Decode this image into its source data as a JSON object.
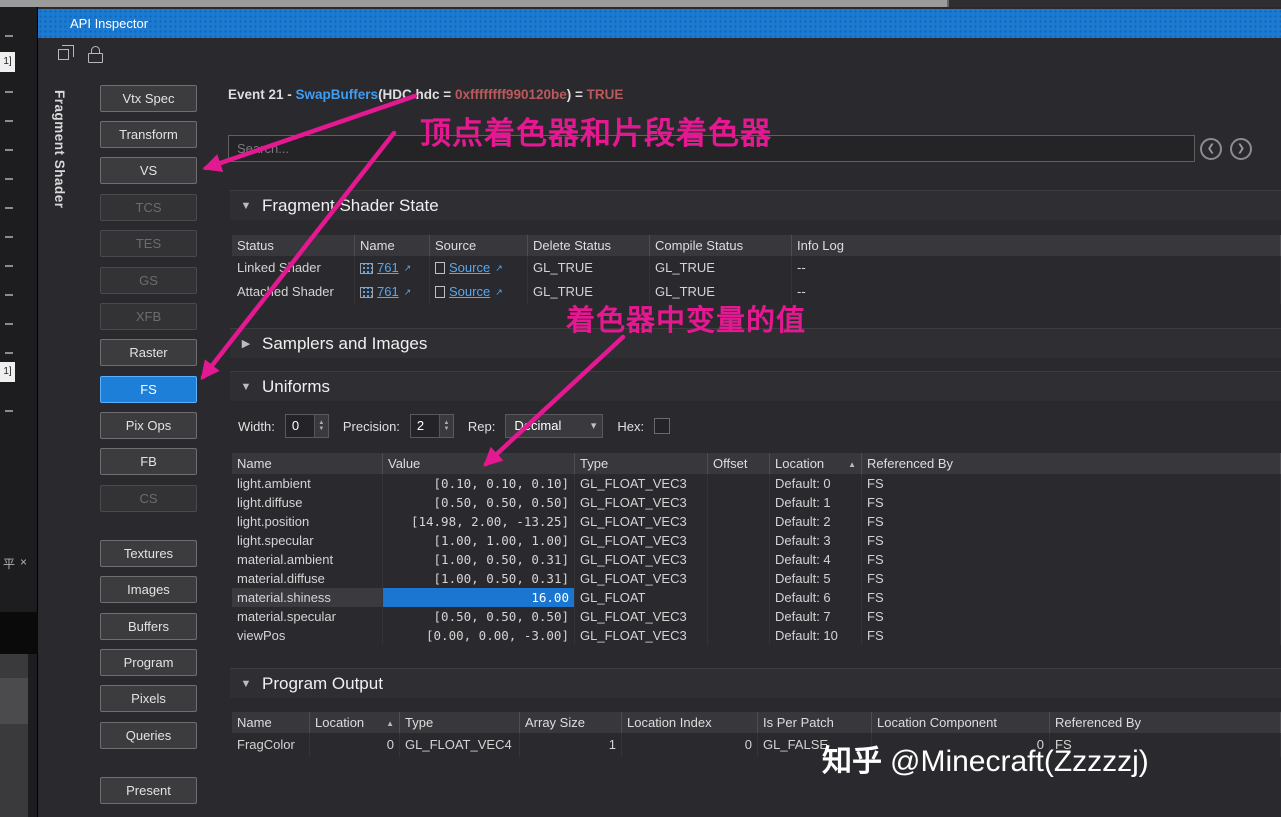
{
  "window": {
    "title": "API Inspector"
  },
  "toolbar": {
    "icons": [
      "clone-icon",
      "lock-icon"
    ]
  },
  "left_rail": {
    "tag1": "1]",
    "tag2": "1]",
    "pin": "平",
    "close": "×"
  },
  "sidebar": {
    "group_label": "Fragment Shader",
    "buttons": [
      {
        "label": "Vtx Spec"
      },
      {
        "label": "Transform"
      },
      {
        "label": "VS"
      },
      {
        "label": "TCS"
      },
      {
        "label": "TES"
      },
      {
        "label": "GS"
      },
      {
        "label": "XFB"
      },
      {
        "label": "Raster"
      },
      {
        "label": "FS"
      },
      {
        "label": "Pix Ops"
      },
      {
        "label": "FB"
      },
      {
        "label": "CS"
      },
      {
        "label": "Textures"
      },
      {
        "label": "Images"
      },
      {
        "label": "Buffers"
      },
      {
        "label": "Program"
      },
      {
        "label": "Pixels"
      },
      {
        "label": "Queries"
      },
      {
        "label": "Present"
      }
    ]
  },
  "event_line": {
    "prefix": "Event 21 - ",
    "func": "SwapBuffers",
    "args_open": "(HDC hdc = ",
    "pointer": "0xffffffff990120be",
    "args_close": ") = ",
    "result": "TRUE"
  },
  "search": {
    "placeholder": "Search..."
  },
  "fragment_shader_state": {
    "title": "Fragment Shader State",
    "columns": [
      "Status",
      "Name",
      "Source",
      "Delete Status",
      "Compile Status",
      "Info Log"
    ],
    "rows": [
      {
        "status": "Linked Shader",
        "name_link": "761",
        "source_link": "Source",
        "delete_status": "GL_TRUE",
        "compile_status": "GL_TRUE",
        "info_log": "--"
      },
      {
        "status": "Attached Shader",
        "name_link": "761",
        "source_link": "Source",
        "delete_status": "GL_TRUE",
        "compile_status": "GL_TRUE",
        "info_log": "--"
      }
    ]
  },
  "samplers_section": {
    "title": "Samplers and Images"
  },
  "uniforms": {
    "title": "Uniforms",
    "controls": {
      "width_label": "Width:",
      "width_value": "0",
      "precision_label": "Precision:",
      "precision_value": "2",
      "rep_label": "Rep:",
      "rep_value": "Decimal",
      "hex_label": "Hex:"
    },
    "columns": [
      "Name",
      "Value",
      "Type",
      "Offset",
      "Location",
      "Referenced By"
    ],
    "sort_column": "Location",
    "rows": [
      {
        "name": "light.ambient",
        "value": "[0.10, 0.10, 0.10]",
        "type": "GL_FLOAT_VEC3",
        "offset": "",
        "location": "Default: 0",
        "referenced_by": "FS"
      },
      {
        "name": "light.diffuse",
        "value": "[0.50, 0.50, 0.50]",
        "type": "GL_FLOAT_VEC3",
        "offset": "",
        "location": "Default: 1",
        "referenced_by": "FS"
      },
      {
        "name": "light.position",
        "value": "[14.98, 2.00, -13.25]",
        "type": "GL_FLOAT_VEC3",
        "offset": "",
        "location": "Default: 2",
        "referenced_by": "FS"
      },
      {
        "name": "light.specular",
        "value": "[1.00, 1.00, 1.00]",
        "type": "GL_FLOAT_VEC3",
        "offset": "",
        "location": "Default: 3",
        "referenced_by": "FS"
      },
      {
        "name": "material.ambient",
        "value": "[1.00, 0.50, 0.31]",
        "type": "GL_FLOAT_VEC3",
        "offset": "",
        "location": "Default: 4",
        "referenced_by": "FS"
      },
      {
        "name": "material.diffuse",
        "value": "[1.00, 0.50, 0.31]",
        "type": "GL_FLOAT_VEC3",
        "offset": "",
        "location": "Default: 5",
        "referenced_by": "FS"
      },
      {
        "name": "material.shiness",
        "value": "16.00",
        "type": "GL_FLOAT",
        "offset": "",
        "location": "Default: 6",
        "referenced_by": "FS"
      },
      {
        "name": "material.specular",
        "value": "[0.50, 0.50, 0.50]",
        "type": "GL_FLOAT_VEC3",
        "offset": "",
        "location": "Default: 7",
        "referenced_by": "FS"
      },
      {
        "name": "viewPos",
        "value": "[0.00, 0.00, -3.00]",
        "type": "GL_FLOAT_VEC3",
        "offset": "",
        "location": "Default: 10",
        "referenced_by": "FS"
      }
    ]
  },
  "program_output": {
    "title": "Program Output",
    "columns": [
      "Name",
      "Location",
      "Type",
      "Array Size",
      "Location Index",
      "Is Per Patch",
      "Location Component",
      "Referenced By"
    ],
    "sort_column": "Location",
    "rows": [
      {
        "name": "FragColor",
        "location": "0",
        "type": "GL_FLOAT_VEC4",
        "array_size": "1",
        "location_index": "0",
        "is_per_patch": "GL_FALSE",
        "location_component": "0",
        "referenced_by": "FS"
      }
    ]
  },
  "annotations": {
    "color": "#e41890",
    "label_shaders": "顶点着色器和片段着色器",
    "label_uniform_values": "着色器中变量的值"
  },
  "watermark": {
    "brand": "知乎",
    "handle": "@Minecraft(Zzzzzj)"
  }
}
